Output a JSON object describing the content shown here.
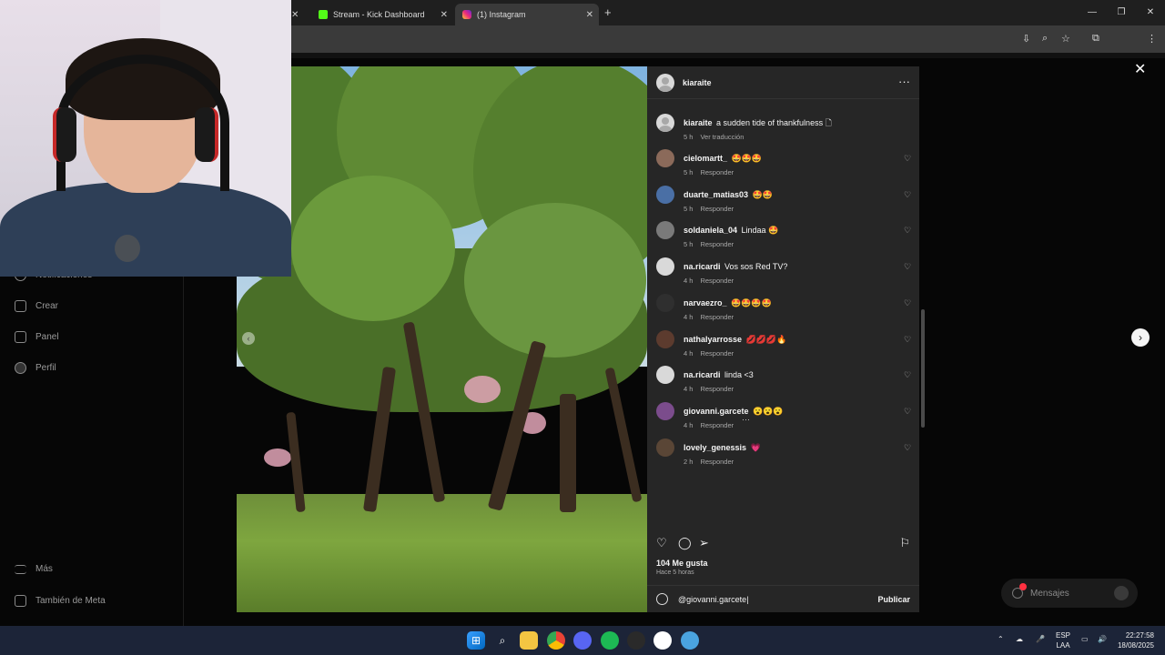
{
  "browser": {
    "tabs": [
      {
        "label": "Stream - Kick Dashboard"
      },
      {
        "label": "(1) Instagram"
      }
    ],
    "new_tab": "+",
    "window_controls": {
      "minimize": "—",
      "maximize": "❐",
      "close": "✕"
    }
  },
  "sidebar": {
    "items": [
      {
        "label": "Notificaciones",
        "icon": "heart-icon"
      },
      {
        "label": "Crear",
        "icon": "plus-square-icon"
      },
      {
        "label": "Panel",
        "icon": "chart-icon"
      },
      {
        "label": "Perfil",
        "icon": "profile-icon"
      },
      {
        "label": "Más",
        "icon": "menu-icon"
      },
      {
        "label": "También de Meta",
        "icon": "meta-icon"
      }
    ]
  },
  "post": {
    "author": "kiaraite",
    "caption_user": "kiaraite",
    "caption": "a sudden tide of thankfulness 🗋",
    "caption_time": "5 h",
    "caption_action": "Ver traducción",
    "comments": [
      {
        "user": "cielomartt_",
        "text": "🤩🤩🤩",
        "time": "5 h",
        "action": "Responder"
      },
      {
        "user": "duarte_matias03",
        "text": "🤩🤩",
        "time": "5 h",
        "action": "Responder"
      },
      {
        "user": "soldaniela_04",
        "text": "Lindaa 🤩",
        "time": "5 h",
        "action": "Responder"
      },
      {
        "user": "na.ricardi",
        "text": "Vos sos Red TV?",
        "time": "4 h",
        "action": "Responder"
      },
      {
        "user": "narvaezro_",
        "text": "🤩🤩🤩🤩",
        "time": "4 h",
        "action": "Responder"
      },
      {
        "user": "nathalyarrosse",
        "text": "💋💋💋🔥",
        "time": "4 h",
        "action": "Responder"
      },
      {
        "user": "na.ricardi",
        "text": "linda <3",
        "time": "4 h",
        "action": "Responder"
      },
      {
        "user": "giovanni.garcete",
        "text": "😮😮😮",
        "time": "4 h",
        "action": "Responder"
      },
      {
        "user": "lovely_genessis",
        "text": "💗",
        "time": "2 h",
        "action": "Responder"
      }
    ],
    "likes": "104 Me gusta",
    "posted_ago": "Hace 5 horas",
    "composer_value": "@giovanni.garcete",
    "publish_label": "Publicar"
  },
  "messages": {
    "label": "Mensajes",
    "badge": "1"
  },
  "taskbar": {
    "language_top": "ESP",
    "language_bottom": "LAA",
    "time": "22:27:58",
    "date": "18/08/2025"
  },
  "colors": {
    "panel": "#262626",
    "taskbar": "#1c2438",
    "badge": "#ff3040"
  }
}
